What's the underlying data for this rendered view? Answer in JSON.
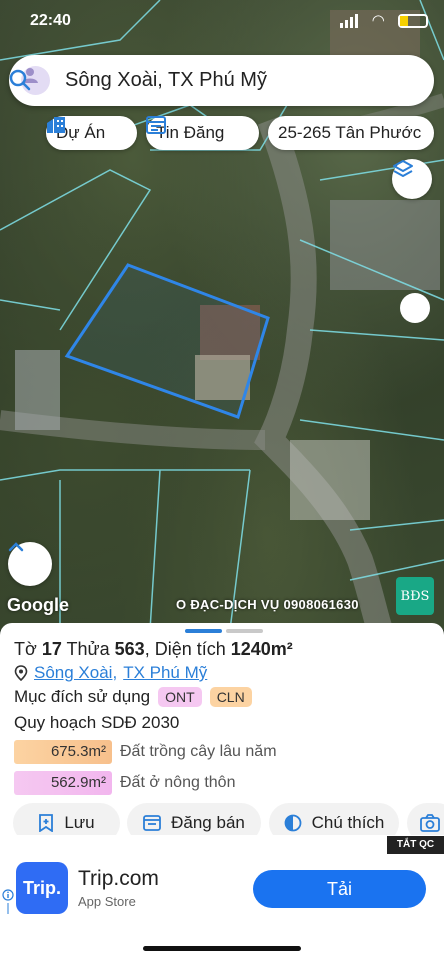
{
  "status_bar": {
    "time": "22:40"
  },
  "search": {
    "query": "Sông Xoài, TX Phú Mỹ"
  },
  "chips": [
    {
      "label": "Dự Án"
    },
    {
      "label": "Tin Đăng"
    },
    {
      "label": "25-265 Tân Phước"
    }
  ],
  "map": {
    "google_label": "Google",
    "credit": "O ĐẠC-DỊCH VỤ 0908061630",
    "watermark_logo": "BĐS"
  },
  "parcel": {
    "sheet_prefix": "Tờ",
    "sheet_no": "17",
    "lot_prefix": "Thửa",
    "lot_no": "563",
    "area_prefix": ", Diện tích",
    "area": "1240m²",
    "commune": "Sông Xoài",
    "town": "TX Phú Mỹ",
    "purpose_label": "Mục đích sử dụng",
    "purpose_badges": [
      "ONT",
      "CLN"
    ],
    "plan_label": "Quy hoạch SDĐ 2030",
    "areas": [
      {
        "value": "675.3m²",
        "label": "Đất trồng cây lâu năm",
        "color": "#fcd3a2"
      },
      {
        "value": "562.9m²",
        "label": "Đất ở nông thôn",
        "color": "#f5c8f1"
      }
    ]
  },
  "actions": {
    "save": "Lưu",
    "post": "Đăng bán",
    "legend": "Chú thích"
  },
  "ad": {
    "close_label": "TẮT QC",
    "logo_text": "Trip.",
    "app_name": "Trip.com",
    "store": "App Store",
    "cta": "Tải"
  },
  "colors": {
    "accent": "#2b7fd8",
    "parcel_outline": "#2f86e8",
    "lot_lines": "#7fe0e8",
    "ad_button": "#1a73f0"
  }
}
